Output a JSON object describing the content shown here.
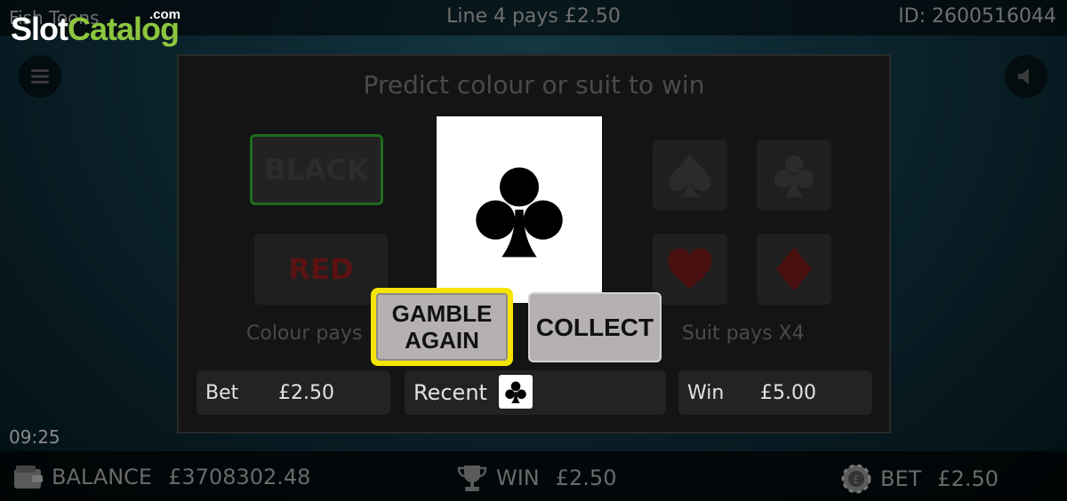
{
  "header": {
    "game_title": "Fish Toons",
    "line_pays": "Line 4 pays £2.50",
    "game_id": "ID: 2600516044"
  },
  "watermark": {
    "slot": "Slot",
    "catalog": "Catalog",
    "com": ".com"
  },
  "clock": "09:25",
  "gamble": {
    "title": "Predict colour or suit to win",
    "black_label": "BLACK",
    "red_label": "RED",
    "colour_pays": "Colour pays",
    "suit_pays": "Suit pays X4",
    "current_card": "club",
    "gamble_again_label": "GAMBLE\nAGAIN",
    "collect_label": "COLLECT",
    "bet_label": "Bet",
    "bet_value": "£2.50",
    "recent_label": "Recent",
    "recent_cards": [
      "club"
    ],
    "win_label": "Win",
    "win_value": "£5.00"
  },
  "bottom_bar": {
    "balance_label": "BALANCE",
    "balance_value": "£3708302.48",
    "win_label": "WIN",
    "win_value": "£2.50",
    "bet_label": "BET",
    "bet_value": "£2.50"
  },
  "colors": {
    "highlight": "#f4e400",
    "button_face": "#b5b1b1",
    "black_outline": "#1f6b1f",
    "red_text": "#5a1212"
  },
  "icons": [
    "menu-icon",
    "sound-icon",
    "wallet-icon",
    "trophy-icon",
    "chip-icon",
    "spade-icon",
    "club-icon",
    "heart-icon",
    "diamond-icon"
  ]
}
